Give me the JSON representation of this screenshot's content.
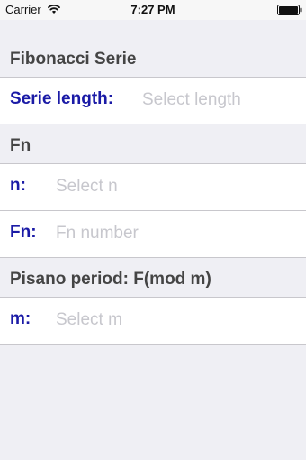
{
  "status_bar": {
    "carrier": "Carrier",
    "time": "7:27 PM",
    "wifi_icon": "wifi-icon",
    "battery_icon": "battery-icon"
  },
  "sections": {
    "fibonacci": {
      "title": "Fibonacci Serie",
      "serie_length": {
        "label": "Serie length:",
        "value": "",
        "placeholder": "Select length"
      }
    },
    "fn": {
      "title": "Fn",
      "n": {
        "label": "n:",
        "value": "",
        "placeholder": "Select n"
      },
      "fn_number": {
        "label": "Fn:",
        "value": "",
        "placeholder": "Fn number"
      }
    },
    "pisano": {
      "title": "Pisano period: F(mod m)",
      "m": {
        "label": "m:",
        "value": "",
        "placeholder": "Select m"
      }
    }
  },
  "colors": {
    "label_blue": "#1a1aa6",
    "background": "#efeff4",
    "placeholder": "#c7c7cd"
  }
}
